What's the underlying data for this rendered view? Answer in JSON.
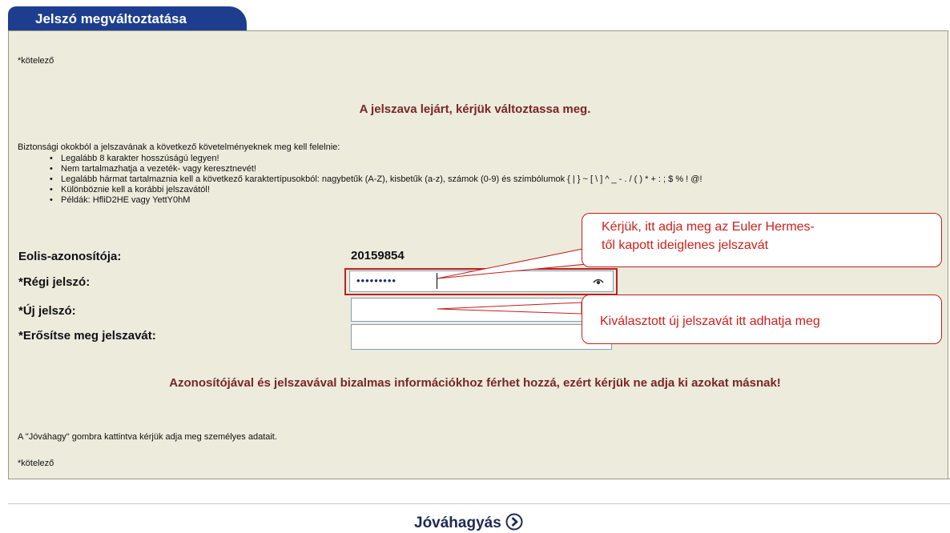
{
  "tab": {
    "title": "Jelszó megváltoztatása"
  },
  "required_note_top": "*kötelező",
  "expired_message": "A jelszava lejárt, kérjük változtassa meg.",
  "requirements": {
    "intro": "Biztonsági okokból a jelszavának a következő követelményeknek meg kell felelnie:",
    "items": [
      "Legalább 8 karakter hosszúságú legyen!",
      "Nem tartalmazhatja a vezeték- vagy keresztnevét!",
      "Legalább hármat tartalmaznia kell a következő karaktertípusokból: nagybetűk (A-Z), kisbetűk (a-z), számok (0-9) és szimbólumok { | } ~ [ \\ ] ^ _ - . / ( ) * + : ; $ % ! @!",
      "Különböznie kell a korábbi jelszavától!",
      "Példák: HfliD2HE vagy YettY0hM"
    ]
  },
  "form": {
    "eolis_label": "Eolis-azonosítója:",
    "eolis_value": "20159854",
    "old_password_label": "*Régi jelszó:",
    "old_password_value": "•••••••••",
    "new_password_label": "*Új jelszó:",
    "confirm_password_label": "*Erősítse meg jelszavát:"
  },
  "callouts": {
    "old_password_line1": "Kérjük, itt adja meg az Euler Hermes-",
    "old_password_line2": "től kapott ideiglenes jelszavát",
    "new_password": "Kiválasztott új jelszavát itt adhatja meg"
  },
  "warning": "Azonosítójával és jelszavával bizalmas információkhoz férhet hozzá, ezért kérjük ne adja ki azokat másnak!",
  "approve_instruction": "A \"Jóváhagy\" gombra kattintva kérjük adja meg személyes adatait.",
  "required_note_bottom": "*kötelező",
  "approve_button": "Jóváhagyás",
  "colors": {
    "tab_blue": "#1d3e8f",
    "panel_bg": "#ecebdc",
    "heading_red": "#7a2626",
    "callout_red": "#d0201c"
  },
  "icons": [
    "eye-icon",
    "arrow-right-circle-icon"
  ]
}
